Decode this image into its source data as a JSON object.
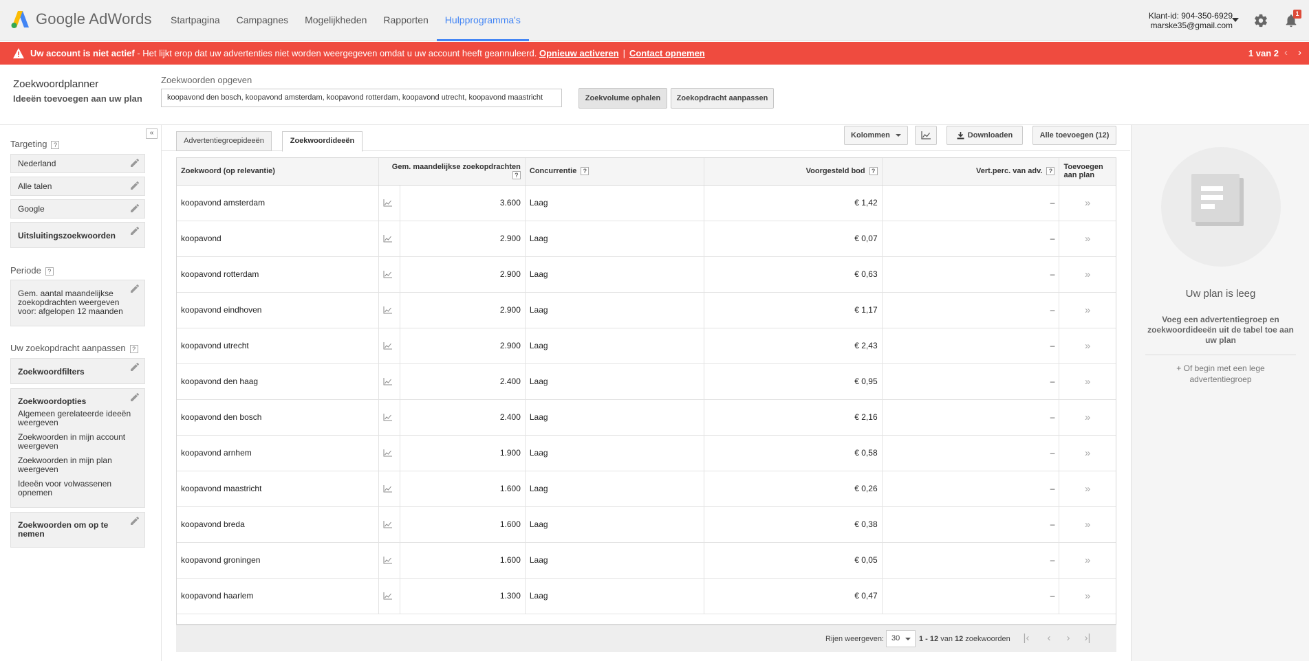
{
  "header": {
    "brand": "Google AdWords",
    "nav": [
      {
        "label": "Startpagina",
        "active": false
      },
      {
        "label": "Campagnes",
        "active": false
      },
      {
        "label": "Mogelijkheden",
        "active": false
      },
      {
        "label": "Rapporten",
        "active": false
      },
      {
        "label": "Hulpprogramma's",
        "active": true
      }
    ],
    "client_id": "Klant-id: 904-350-6929",
    "email": "marske35@gmail.com",
    "notification_count": "1",
    "icons": [
      "adwords-logo-icon",
      "chevron-down-icon",
      "gear-icon",
      "bell-icon"
    ]
  },
  "alert": {
    "bold": "Uw account is niet actief",
    "text": " - Het lijkt erop dat uw advertenties niet worden weergegeven omdat u uw account heeft geannuleerd.",
    "link1": "Opnieuw activeren",
    "separator": "|",
    "link2": "Contact opnemen",
    "page": "1 van 2",
    "color": "#ef4b3f"
  },
  "planner": {
    "title": "Zoekwoordplanner",
    "subtitle": "Ideeën toevoegen aan uw plan",
    "keywords_label": "Zoekwoorden opgeven",
    "keywords_value": "koopavond den bosch, koopavond amsterdam, koopavond rotterdam, koopavond utrecht, koopavond maastricht",
    "btn_volume": "Zoekvolume ophalen",
    "btn_adjust": "Zoekopdracht aanpassen"
  },
  "sidebar": {
    "collapse": "«",
    "targeting_label": "Targeting",
    "help": "?",
    "targeting": [
      "Nederland",
      "Alle talen",
      "Google",
      "Uitsluitingszoekwoorden"
    ],
    "period_label": "Periode",
    "period_lines": [
      "Gem. aantal maandelijkse",
      "zoekopdrachten weergeven",
      "voor: afgelopen 12 maanden"
    ],
    "adjust_label": "Uw zoekopdracht aanpassen",
    "filters": "Zoekwoordfilters",
    "options_title": "Zoekwoordopties",
    "options": [
      [
        "Algemeen gerelateerde ideeën",
        "weergeven"
      ],
      [
        "Zoekwoorden in mijn account",
        "weergeven"
      ],
      [
        "Zoekwoorden in mijn plan",
        "weergeven"
      ],
      [
        "Ideeën voor volwassenen",
        "opnemen"
      ]
    ],
    "include_lines": [
      "Zoekwoorden om op te",
      "nemen"
    ]
  },
  "tabs": [
    "Advertentiegroepideeën",
    "Zoekwoordideeën"
  ],
  "toolbar": {
    "columns": "Kolommen",
    "download": "Downloaden",
    "add_all": "Alle toevoegen (12)"
  },
  "table": {
    "headers": {
      "keyword": "Zoekwoord (op relevantie)",
      "searches": "Gem. maandelijkse zoekopdrachten",
      "competition": "Concurrentie",
      "bid": "Voorgesteld bod",
      "adshare": "Vert.perc. van adv.",
      "add1": "Toevoegen",
      "add2": "aan plan"
    },
    "rows": [
      {
        "keyword": "koopavond amsterdam",
        "searches": "3.600",
        "competition": "Laag",
        "bid": "€ 1,42",
        "adshare": "–",
        "add": "»"
      },
      {
        "keyword": "koopavond",
        "searches": "2.900",
        "competition": "Laag",
        "bid": "€ 0,07",
        "adshare": "–",
        "add": "»"
      },
      {
        "keyword": "koopavond rotterdam",
        "searches": "2.900",
        "competition": "Laag",
        "bid": "€ 0,63",
        "adshare": "–",
        "add": "»"
      },
      {
        "keyword": "koopavond eindhoven",
        "searches": "2.900",
        "competition": "Laag",
        "bid": "€ 1,17",
        "adshare": "–",
        "add": "»"
      },
      {
        "keyword": "koopavond utrecht",
        "searches": "2.900",
        "competition": "Laag",
        "bid": "€ 2,43",
        "adshare": "–",
        "add": "»"
      },
      {
        "keyword": "koopavond den haag",
        "searches": "2.400",
        "competition": "Laag",
        "bid": "€ 0,95",
        "adshare": "–",
        "add": "»"
      },
      {
        "keyword": "koopavond den bosch",
        "searches": "2.400",
        "competition": "Laag",
        "bid": "€ 2,16",
        "adshare": "–",
        "add": "»"
      },
      {
        "keyword": "koopavond arnhem",
        "searches": "1.900",
        "competition": "Laag",
        "bid": "€ 0,58",
        "adshare": "–",
        "add": "»"
      },
      {
        "keyword": "koopavond maastricht",
        "searches": "1.600",
        "competition": "Laag",
        "bid": "€ 0,26",
        "adshare": "–",
        "add": "»"
      },
      {
        "keyword": "koopavond breda",
        "searches": "1.600",
        "competition": "Laag",
        "bid": "€ 0,38",
        "adshare": "–",
        "add": "»"
      },
      {
        "keyword": "koopavond groningen",
        "searches": "1.600",
        "competition": "Laag",
        "bid": "€ 0,05",
        "adshare": "–",
        "add": "»"
      },
      {
        "keyword": "koopavond haarlem",
        "searches": "1.300",
        "competition": "Laag",
        "bid": "€ 0,47",
        "adshare": "–",
        "add": "»"
      }
    ]
  },
  "pager": {
    "rows_label": "Rijen weergeven:",
    "rows_value": "30",
    "range_prefix": "1 - 12",
    "range_mid": " van ",
    "range_total": "12",
    "range_suffix": " zoekwoorden"
  },
  "plan": {
    "title": "Uw plan is leeg",
    "desc": "Voeg een advertentiegroep en zoekwoordideeën uit de tabel toe aan uw plan",
    "link": "+ Of begin met een lege advertentiegroep"
  },
  "colors": {
    "accent": "#4285f4",
    "alert": "#ef4b3f"
  }
}
